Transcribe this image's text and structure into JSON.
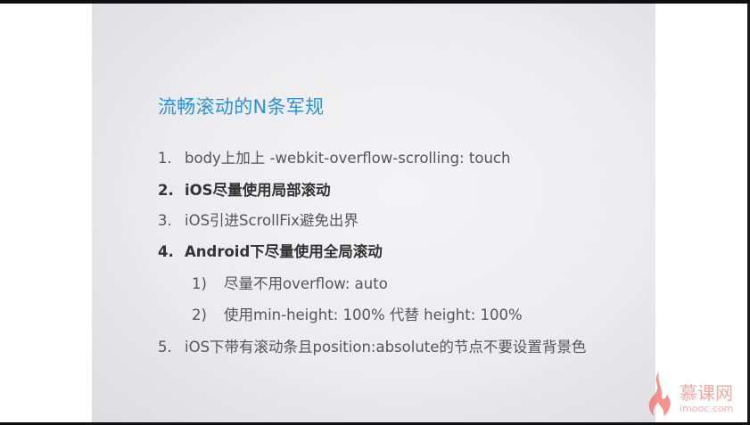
{
  "slide": {
    "title": "流畅滚动的N条军规",
    "items": [
      {
        "num": "1.",
        "text": "body上加上 -webkit-overflow-scrolling: touch"
      },
      {
        "num": "2.",
        "text": "iOS尽量使用局部滚动"
      },
      {
        "num": "3.",
        "text": "iOS引进ScrollFix避免出界"
      },
      {
        "num": "4.",
        "text": "Android下尽量使用全局滚动"
      },
      {
        "num": "1)",
        "text": "尽量不用overflow: auto"
      },
      {
        "num": "2)",
        "text": "使用min-height: 100% 代替 height: 100%"
      },
      {
        "num": "5.",
        "text": "iOS下带有滚动条且position:absolute的节点不要设置背景色"
      }
    ]
  },
  "watermark": {
    "name": "慕课网",
    "url": "imooc.com",
    "color": "#e8625a"
  }
}
